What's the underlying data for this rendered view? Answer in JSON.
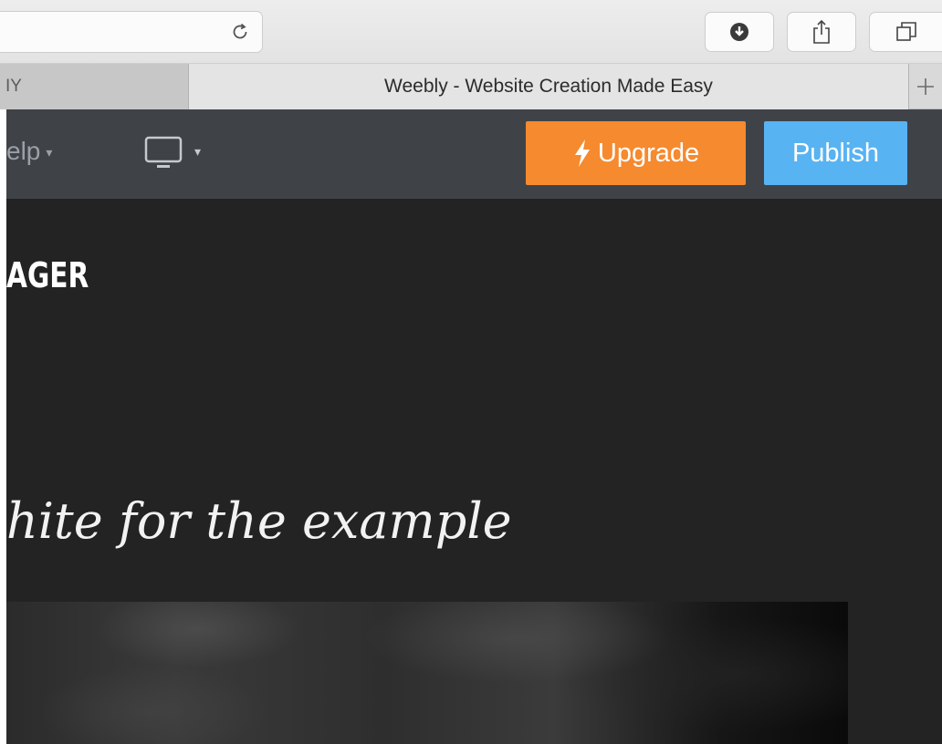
{
  "browser": {
    "active_tab_title": "Weebly - Website Creation Made Easy",
    "inactive_tab_title": "IY",
    "new_tab_label": "+"
  },
  "editor": {
    "help_label": "elp",
    "upgrade_label": "Upgrade",
    "publish_label": "Publish",
    "colors": {
      "upgrade": "#f68a2f",
      "publish": "#58b3f2",
      "bar": "#3f4348"
    }
  },
  "site": {
    "title": "AGER",
    "tagline": "hite for the example"
  }
}
